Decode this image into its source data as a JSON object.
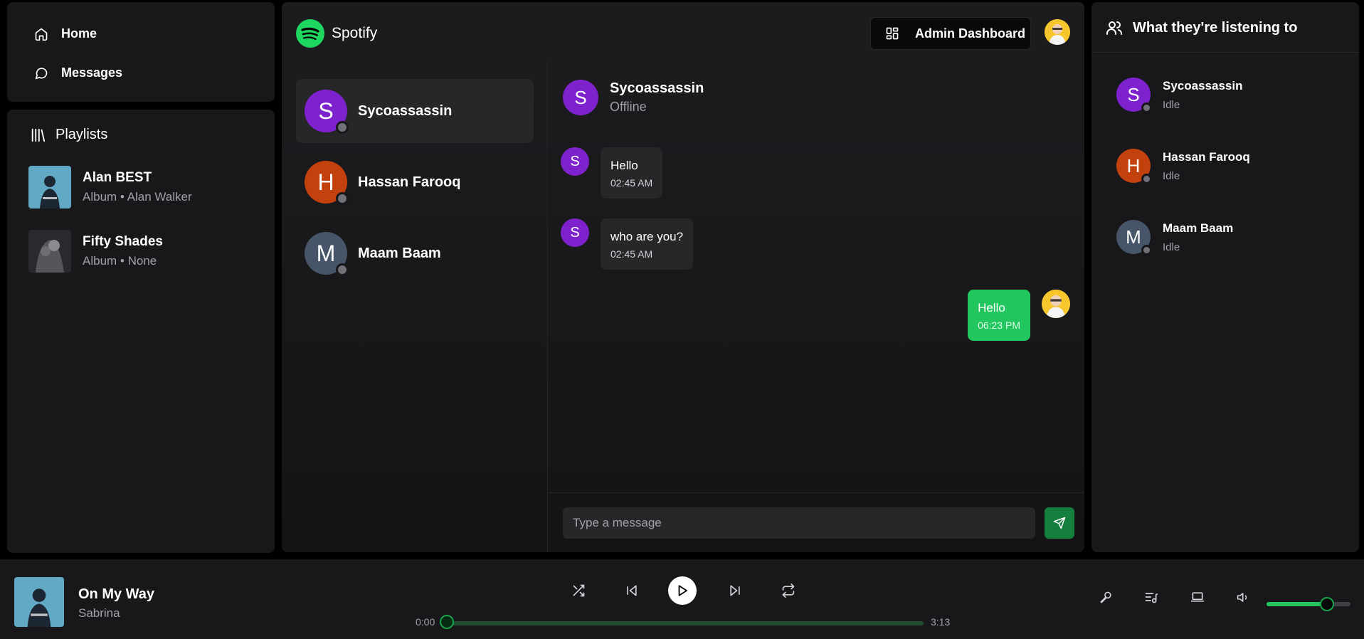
{
  "nav": {
    "home": "Home",
    "messages": "Messages"
  },
  "playlists": {
    "title": "Playlists",
    "items": [
      {
        "title": "Alan BEST",
        "subtitle": "Album • Alan Walker"
      },
      {
        "title": "Fifty Shades",
        "subtitle": "Album • None"
      }
    ]
  },
  "header": {
    "logo_text": "Spotify",
    "admin_button": "Admin Dashboard"
  },
  "users": [
    {
      "initial": "S",
      "name": "Sycoassassin",
      "color": "#7e22ce",
      "active": true
    },
    {
      "initial": "H",
      "name": "Hassan Farooq",
      "color": "#c2410c",
      "active": false
    },
    {
      "initial": "M",
      "name": "Maam Baam",
      "color": "#475569",
      "active": false
    }
  ],
  "chat": {
    "header_initial": "S",
    "header_name": "Sycoassassin",
    "header_status": "Offline",
    "messages": [
      {
        "initial": "S",
        "text": "Hello",
        "time": "02:45 AM",
        "own": false
      },
      {
        "initial": "S",
        "text": "who are you?",
        "time": "02:45 AM",
        "own": false
      },
      {
        "text": "Hello",
        "time": "06:23 PM",
        "own": true
      }
    ],
    "input_placeholder": "Type a message"
  },
  "friends": {
    "title": "What they're listening to",
    "items": [
      {
        "initial": "S",
        "name": "Sycoassassin",
        "status": "Idle",
        "color": "#7e22ce"
      },
      {
        "initial": "H",
        "name": "Hassan Farooq",
        "status": "Idle",
        "color": "#c2410c"
      },
      {
        "initial": "M",
        "name": "Maam Baam",
        "status": "Idle",
        "color": "#475569"
      }
    ]
  },
  "player": {
    "title": "On My Way",
    "artist": "Sabrina",
    "current_time": "0:00",
    "total_time": "3:13",
    "progress": 0,
    "volume": 0.72
  },
  "colors": {
    "accent": "#22c55e",
    "panel": "#18181b",
    "offline_dot": "#71717a"
  },
  "icons": {
    "home": "home-icon",
    "messages": "message-circle-icon",
    "playlists": "library-icon",
    "admin": "layout-dashboard-icon",
    "friends": "users-icon",
    "send": "send-icon",
    "shuffle": "shuffle-icon",
    "prev": "skip-back-icon",
    "play": "play-icon",
    "next": "skip-forward-icon",
    "repeat": "repeat-icon",
    "mic": "mic-icon",
    "queue": "list-music-icon",
    "device": "laptop-icon",
    "volume": "volume-icon"
  }
}
